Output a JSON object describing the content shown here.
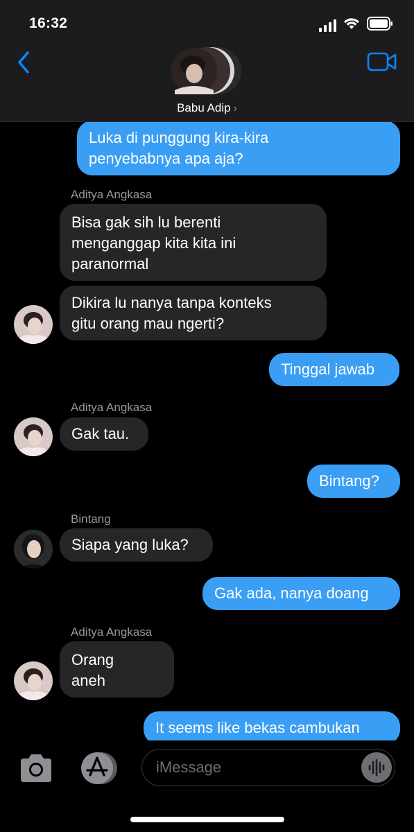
{
  "status_bar": {
    "time": "16:32"
  },
  "header": {
    "contact_name": "Babu Adip",
    "chevron": "›"
  },
  "messages": [
    {
      "direction": "out",
      "lines": [
        "Luka di punggung kira-kira",
        "penyebabnya apa aja?"
      ]
    },
    {
      "direction": "in",
      "sender": "Aditya Angkasa",
      "lines": [
        "Bisa gak sih lu berenti",
        "menganggap kita kita ini",
        "paranormal"
      ]
    },
    {
      "direction": "in",
      "lines": [
        "Dikira lu nanya tanpa konteks",
        "gitu orang mau ngerti?"
      ]
    },
    {
      "direction": "out",
      "lines": [
        "Tinggal jawab"
      ]
    },
    {
      "direction": "in",
      "sender": "Aditya Angkasa",
      "lines": [
        "Gak tau."
      ]
    },
    {
      "direction": "out",
      "lines": [
        "Bintang?"
      ]
    },
    {
      "direction": "in",
      "sender": "Bintang",
      "lines": [
        "Siapa yang luka?"
      ]
    },
    {
      "direction": "out",
      "lines": [
        "Gak ada, nanya doang"
      ]
    },
    {
      "direction": "in",
      "sender": "Aditya Angkasa",
      "lines": [
        "Orang",
        "aneh"
      ]
    },
    {
      "direction": "out",
      "lines": [
        "It seems like bekas cambukan"
      ]
    }
  ],
  "input": {
    "placeholder": "iMessage"
  },
  "colors": {
    "accent": "#0a84ff",
    "outgoing_bubble": "#3a9ef5",
    "incoming_bubble": "#262628",
    "header_bg": "#1c1c1e"
  },
  "icons": [
    "signal-icon",
    "wifi-icon",
    "battery-icon",
    "back-chevron-icon",
    "video-camera-icon",
    "camera-icon",
    "app-store-icon",
    "audio-waveform-icon"
  ]
}
